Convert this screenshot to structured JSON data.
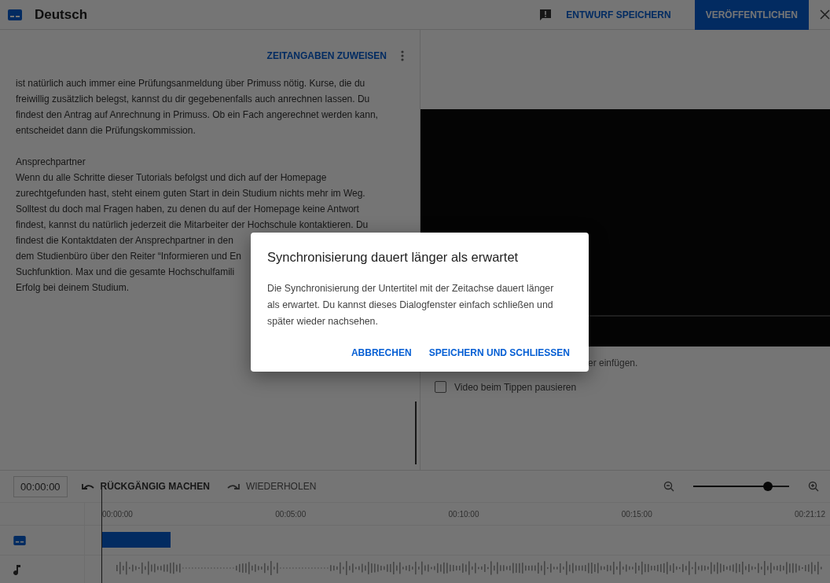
{
  "header": {
    "title": "Deutsch",
    "draft_button": "ENTWURF SPEICHERN",
    "publish_button": "VERÖFFENTLICHEN"
  },
  "editor": {
    "assign_button": "ZEITANGABEN ZUWEISEN",
    "paragraphs": [
      {
        "lines": [
          "ist natürlich auch immer eine Prüfungsanmeldung über Primuss nötig. Kurse, die du",
          "freiwillig zusätzlich belegst, kannst du dir gegebenenfalls auch anrechnen lassen. Du",
          "findest den Antrag auf Anrechnung in Primuss. Ob ein Fach angerechnet werden kann,",
          "entscheidet dann die Prüfungskommission."
        ]
      },
      {
        "lines": [
          "Ansprechpartner",
          "Wenn du alle Schritte dieser Tutorials befolgst und dich auf der Homepage",
          "zurechtgefunden hast, steht einem guten Start in dein Studium nichts mehr im Weg.",
          "Solltest du doch mal Fragen haben, zu denen du auf der Homepage keine Antwort",
          "findest, kannst du natürlich jederzeit die Mitarbeiter der Hochschule kontaktieren. Du",
          "findest die Kontaktdaten der Ansprechpartner in den",
          "dem Studienbüro über den Reiter “Informieren und En",
          "Suchfunktion. Max und die gesamte Hochschulfamili",
          "Erfolg bei deinem Studium."
        ]
      }
    ]
  },
  "preview": {
    "hint": "er einfügen.",
    "pause_checkbox": {
      "label": "Video beim Tippen pausieren",
      "checked": false
    }
  },
  "timeline": {
    "time": "00:00:00",
    "undo_button": "RÜCKGÄNGIG MACHEN",
    "redo_button": "WIEDERHOLEN",
    "zoom": {
      "level": 0.78
    },
    "ticks": [
      "00:00:00",
      "00:05:00",
      "00:10:00",
      "00:15:00",
      "00:21:12"
    ]
  },
  "dialog": {
    "title": "Synchronisierung dauert länger als erwartet",
    "message": "Die Synchronisierung der Untertitel mit der Zeitachse dauert länger als erwartet. Du kannst dieses Dialogfenster einfach schließen und später wieder nachsehen.",
    "buttons": [
      "ABBRECHEN",
      "SPEICHERN UND SCHLIESSEN"
    ]
  }
}
